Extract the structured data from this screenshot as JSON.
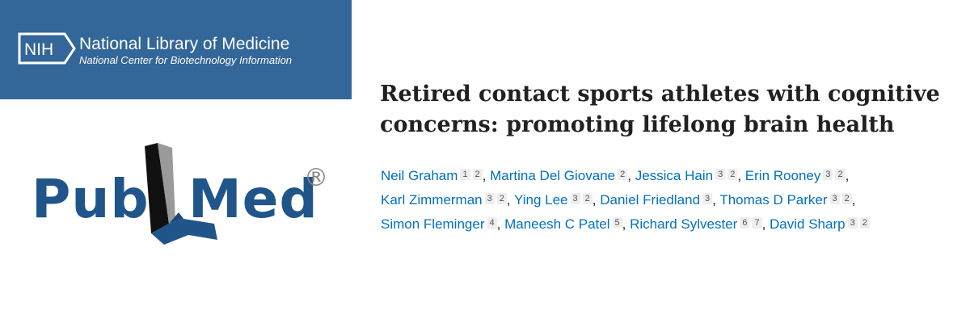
{
  "nih": {
    "badge": "NIH",
    "name": "National Library of Medicine",
    "subtitle": "National Center for Biotechnology Information"
  },
  "pubmed": {
    "pub": "Pub",
    "med": "Med",
    "registered": "®"
  },
  "article": {
    "title": "Retired contact sports athletes with cognitive concerns: promoting lifelong brain health"
  },
  "authors": [
    {
      "name": "Neil Graham",
      "affiliations": [
        "1",
        "2"
      ]
    },
    {
      "name": "Martina Del Giovane",
      "affiliations": [
        "2"
      ]
    },
    {
      "name": "Jessica Hain",
      "affiliations": [
        "3",
        "2"
      ]
    },
    {
      "name": "Erin Rooney",
      "affiliations": [
        "3",
        "2"
      ]
    },
    {
      "name": "Karl Zimmerman",
      "affiliations": [
        "3",
        "2"
      ]
    },
    {
      "name": "Ying Lee",
      "affiliations": [
        "3",
        "2"
      ]
    },
    {
      "name": "Daniel Friedland",
      "affiliations": [
        "3"
      ]
    },
    {
      "name": "Thomas D Parker",
      "affiliations": [
        "3",
        "2"
      ]
    },
    {
      "name": "Simon Fleminger",
      "affiliations": [
        "4"
      ]
    },
    {
      "name": "Maneesh C Patel",
      "affiliations": [
        "5"
      ]
    },
    {
      "name": "Richard Sylvester",
      "affiliations": [
        "6",
        "7"
      ]
    },
    {
      "name": "David Sharp",
      "affiliations": [
        "3",
        "2"
      ]
    }
  ],
  "colors": {
    "nih_blue": "#336699",
    "pubmed_blue": "#20558a",
    "link_blue": "#0071bc"
  }
}
